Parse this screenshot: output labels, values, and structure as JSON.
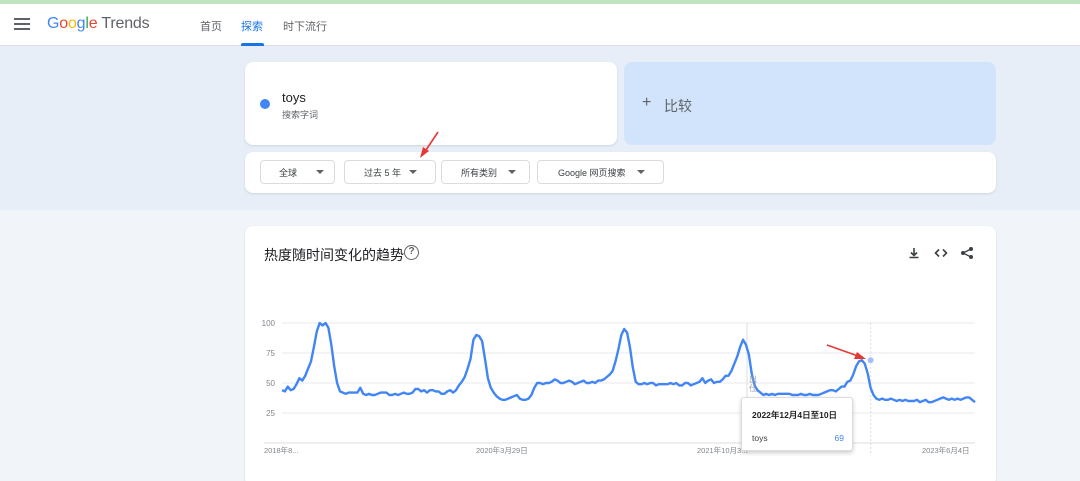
{
  "header": {
    "logo": {
      "g1": "G",
      "g2": "o",
      "g3": "o",
      "g4": "g",
      "g5": "l",
      "g6": "e",
      "product": "Trends"
    },
    "nav": [
      "首页",
      "探索",
      "时下流行"
    ],
    "active_tab": "探索"
  },
  "search": {
    "term": "toys",
    "term_sub": "搜索字词",
    "term_color": "#4285f4",
    "compare_label": "比较"
  },
  "filters": [
    {
      "label": "全球"
    },
    {
      "label": "过去 5 年"
    },
    {
      "label": "所有类别"
    },
    {
      "label": "Google 网页搜索"
    }
  ],
  "chart_section": {
    "title": "热度随时间变化的趋势",
    "icons": [
      "download-icon",
      "embed-icon",
      "share-icon"
    ]
  },
  "tooltip": {
    "date": "2022年12月4日至10日",
    "term": "toys",
    "value": "69"
  },
  "annotation_label": "出\n仕",
  "chart_data": {
    "type": "line",
    "y_ticks": [
      100,
      75,
      50,
      25
    ],
    "ylim": [
      0,
      100
    ],
    "x_tick_labels": [
      "2018年8...",
      "2020年3月29日",
      "2021年10月3...",
      "2023年6月4日"
    ],
    "grid": true,
    "series": [
      {
        "name": "toys",
        "color": "#4285f4",
        "values": [
          44,
          43,
          47,
          44,
          45,
          49,
          54,
          52,
          56,
          62,
          68,
          80,
          93,
          100,
          98,
          100,
          96,
          82,
          64,
          50,
          43,
          42,
          41,
          42,
          42,
          42,
          42,
          46,
          41,
          40,
          41,
          40,
          40,
          41,
          42,
          42,
          42,
          40,
          40,
          41,
          40,
          41,
          42,
          41,
          41,
          42,
          45,
          45,
          43,
          44,
          42,
          44,
          44,
          43,
          43,
          41,
          41,
          43,
          44,
          42,
          44,
          48,
          51,
          55,
          62,
          70,
          86,
          90,
          89,
          85,
          70,
          54,
          46,
          42,
          39,
          37,
          36,
          36,
          37,
          38,
          39,
          40,
          37,
          36,
          36,
          37,
          40,
          46,
          50,
          50,
          49,
          50,
          50,
          51,
          53,
          52,
          50,
          50,
          51,
          52,
          51,
          49,
          50,
          51,
          52,
          50,
          50,
          51,
          50,
          52,
          52,
          53,
          55,
          57,
          60,
          68,
          78,
          90,
          95,
          92,
          80,
          63,
          51,
          49,
          49,
          50,
          49,
          50,
          50,
          48,
          49,
          49,
          49,
          49,
          50,
          49,
          50,
          48,
          48,
          50,
          50,
          48,
          49,
          50,
          51,
          54,
          50,
          52,
          53,
          50,
          51,
          51,
          53,
          56,
          56,
          60,
          66,
          72,
          80,
          86,
          82,
          74,
          58,
          48,
          44,
          42,
          40,
          41,
          40,
          41,
          40,
          41,
          41,
          41,
          41,
          41,
          40,
          40,
          40,
          41,
          40,
          40,
          41,
          40,
          40,
          40,
          41,
          42,
          43,
          44,
          44,
          43,
          45,
          47,
          47,
          51,
          52,
          57,
          64,
          68,
          69,
          66,
          58,
          46,
          40,
          37,
          36,
          37,
          36,
          36,
          37,
          36,
          35,
          36,
          35,
          36,
          35,
          35,
          35,
          36,
          34,
          35,
          36,
          34,
          34,
          35,
          36,
          37,
          38,
          37,
          36,
          37,
          36,
          37,
          36,
          37,
          38,
          38,
          36,
          34
        ]
      }
    ],
    "highlight_index": 203,
    "highlight_value": 69
  }
}
